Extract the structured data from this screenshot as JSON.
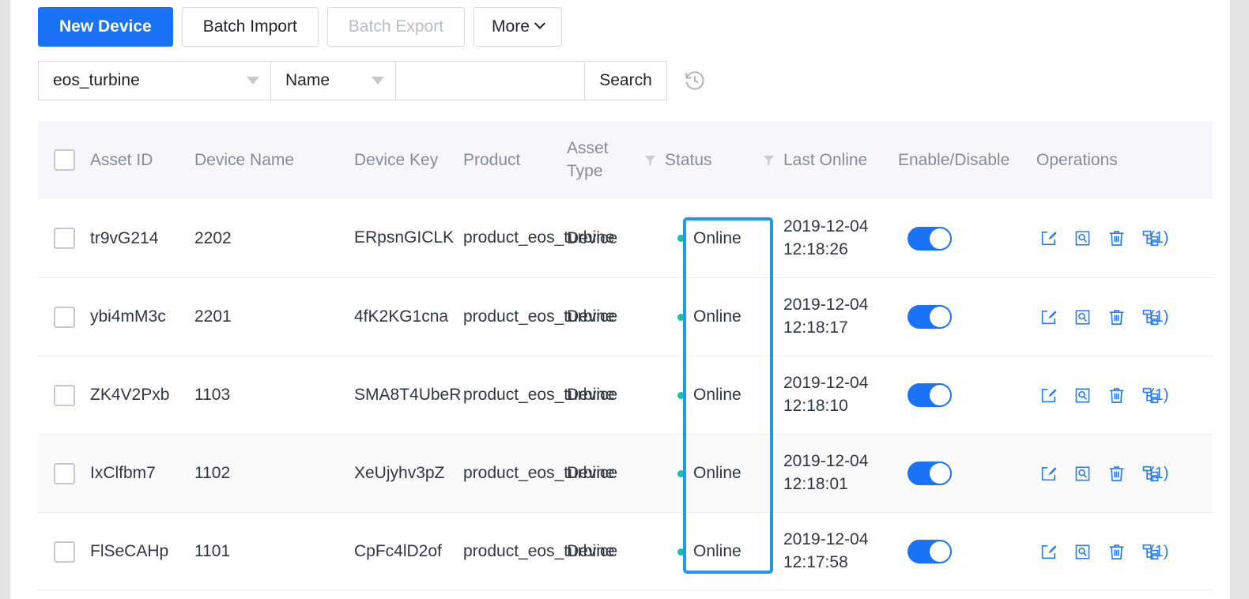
{
  "toolbar": {
    "new_device": "New Device",
    "batch_import": "Batch Import",
    "batch_export": "Batch Export",
    "more": "More"
  },
  "search": {
    "product_value": "eos_turbine",
    "field_value": "Name",
    "keyword_value": "",
    "keyword_placeholder": "",
    "search_button": "Search",
    "history_icon": "history-clock-icon"
  },
  "table": {
    "columns": {
      "asset_id": "Asset ID",
      "device_name": "Device Name",
      "device_key": "Device Key",
      "product": "Product",
      "asset_type": "Asset Type",
      "status": "Status",
      "last_online": "Last Online",
      "enable_disable": "Enable/Disable",
      "operations": "Operations"
    },
    "rows": [
      {
        "asset_id": "tr9vG214",
        "device_name": "2202",
        "device_key": "ERpsnGICLK",
        "product": "product_eos_turbine",
        "asset_type": "Device",
        "status": "Online",
        "last_online": "2019-12-04 12:18:26",
        "enabled": true,
        "sub_count": "(1)"
      },
      {
        "asset_id": "ybi4mM3c",
        "device_name": "2201",
        "device_key": "4fK2KG1cna",
        "product": "product_eos_turbine",
        "asset_type": "Device",
        "status": "Online",
        "last_online": "2019-12-04 12:18:17",
        "enabled": true,
        "sub_count": "(1)"
      },
      {
        "asset_id": "ZK4V2Pxb",
        "device_name": "1103",
        "device_key": "SMA8T4UbeR",
        "product": "product_eos_turbine",
        "asset_type": "Device",
        "status": "Online",
        "last_online": "2019-12-04 12:18:10",
        "enabled": true,
        "sub_count": "(1)"
      },
      {
        "asset_id": "IxClfbm7",
        "device_name": "1102",
        "device_key": "XeUjyhv3pZ",
        "product": "product_eos_turbine",
        "asset_type": "Device",
        "status": "Online",
        "last_online": "2019-12-04 12:18:01",
        "enabled": true,
        "sub_count": "(1)"
      },
      {
        "asset_id": "FlSeCAHp",
        "device_name": "1101",
        "device_key": "CpFc4lD2of",
        "product": "product_eos_turbine",
        "asset_type": "Device",
        "status": "Online",
        "last_online": "2019-12-04 12:17:58",
        "enabled": true,
        "sub_count": "(1)"
      }
    ]
  },
  "colors": {
    "primary": "#1a73f5",
    "online_dot": "#13c2a5",
    "highlight": "#2196f3",
    "header_bg": "#f7f7fb",
    "link": "#2b7ef2"
  },
  "annotation": {
    "highlight_target": "status-column"
  }
}
